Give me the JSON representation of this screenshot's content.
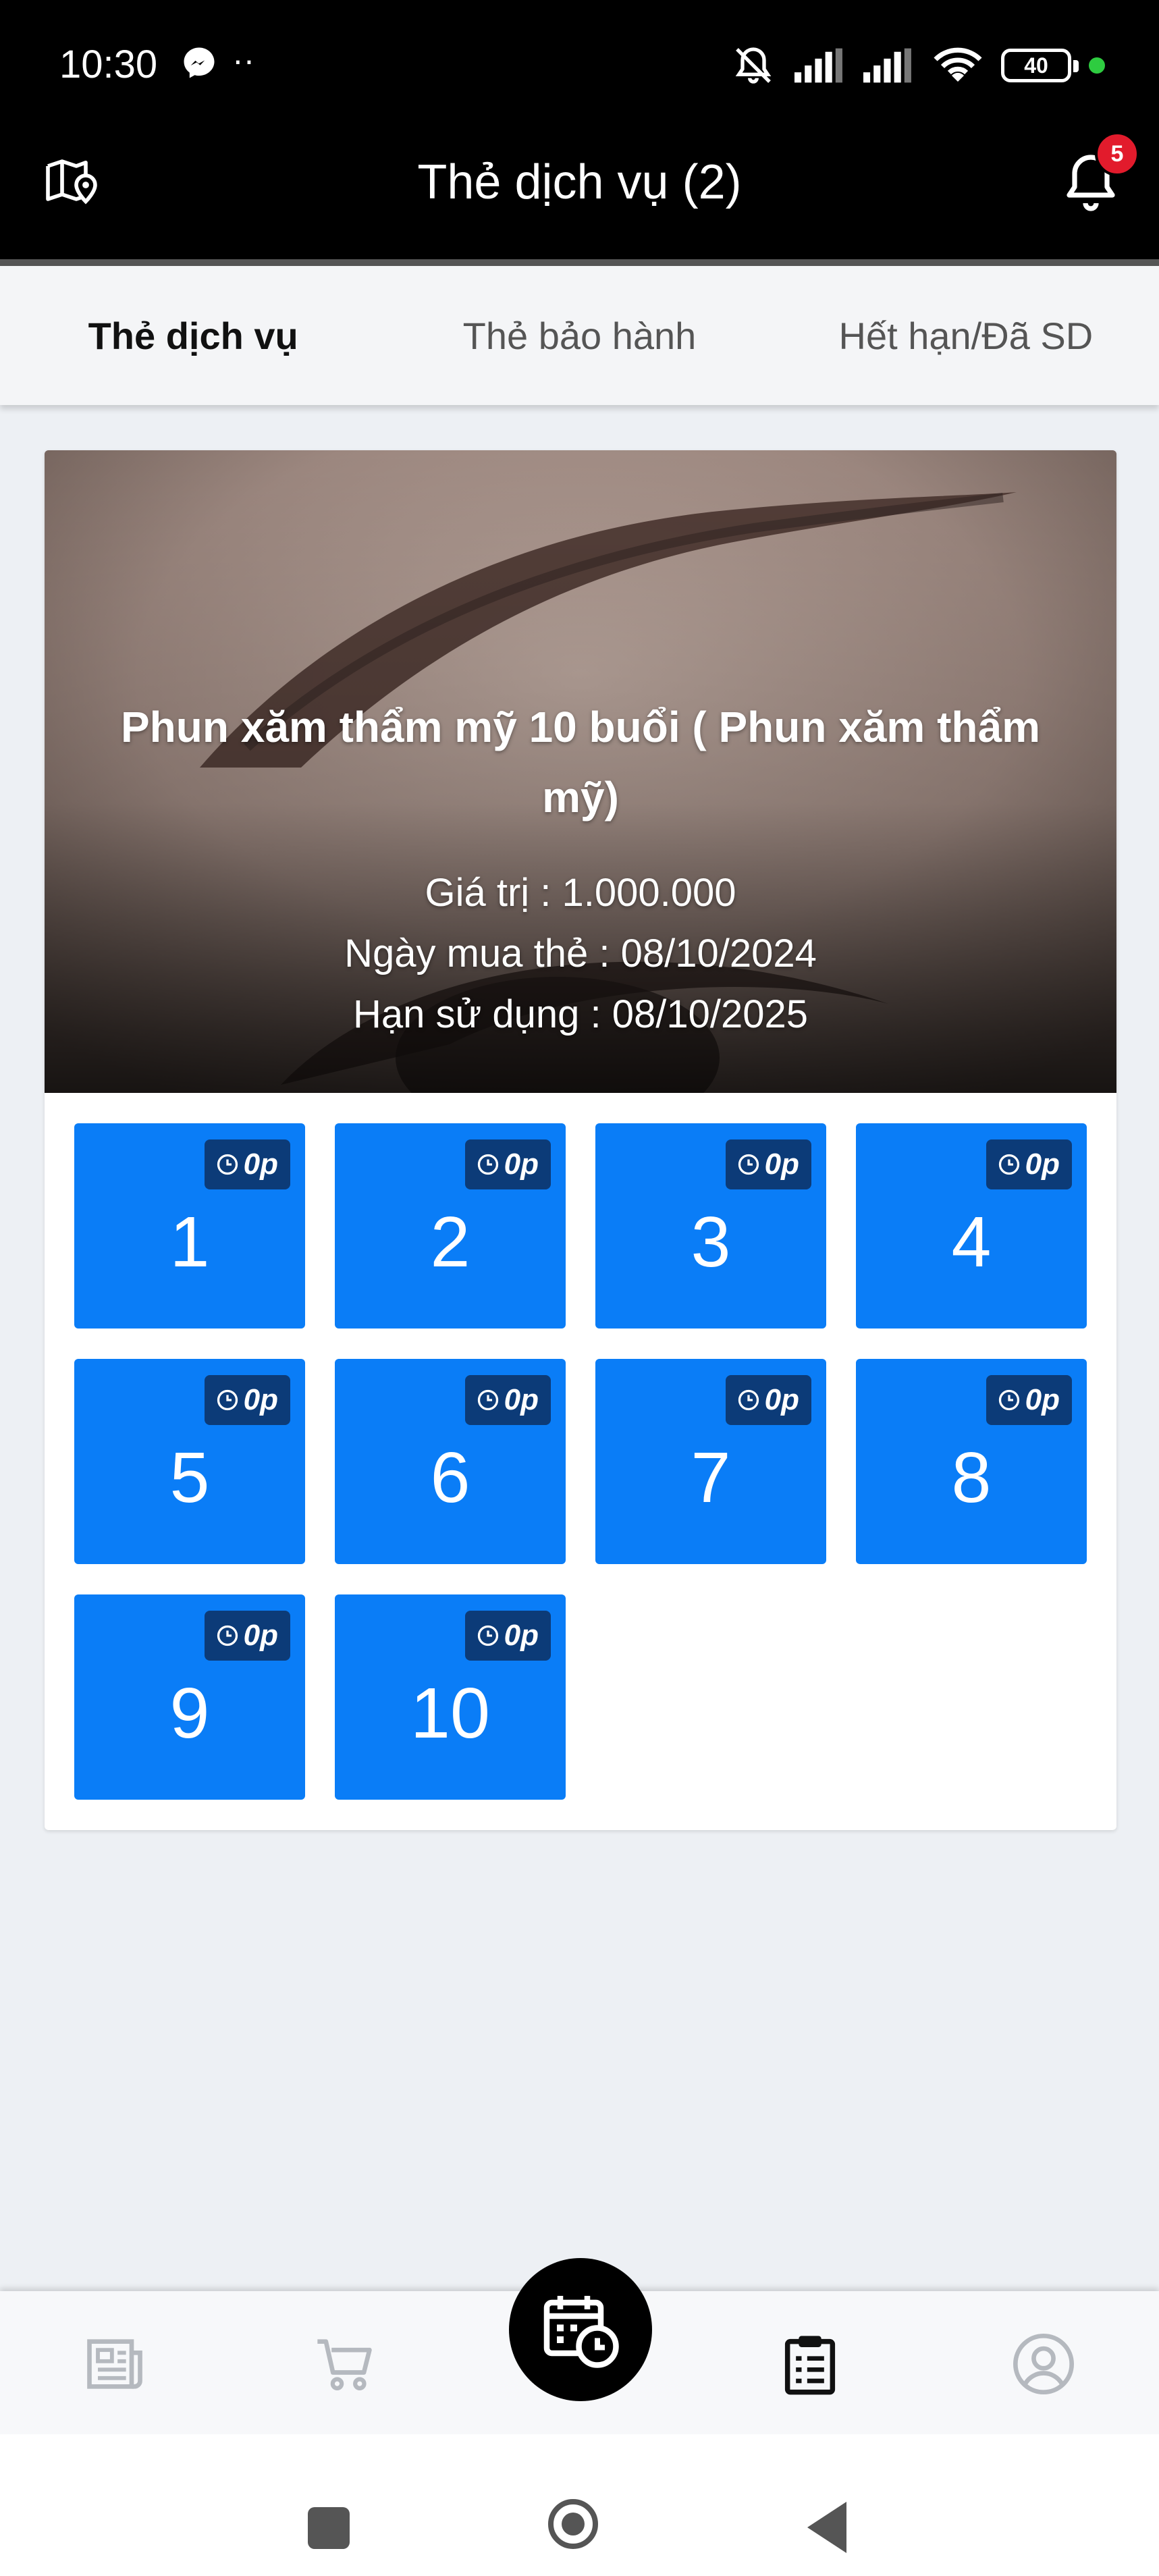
{
  "status_bar": {
    "time": "10:30",
    "dots": "··",
    "battery": "40"
  },
  "header": {
    "title": "Thẻ dịch vụ (2)",
    "notification_count": "5"
  },
  "tabs": [
    {
      "label": "Thẻ dịch vụ",
      "active": true
    },
    {
      "label": "Thẻ bảo hành",
      "active": false
    },
    {
      "label": "Hết hạn/Đã SD",
      "active": false
    }
  ],
  "card": {
    "title": "Phun xăm thẩm mỹ 10 buổi ( Phun xăm thẩm mỹ)",
    "value_line": "Giá trị : 1.000.000",
    "purchase_line": "Ngày mua thẻ : 08/10/2024",
    "expiry_line": "Hạn sử dụng : 08/10/2025",
    "sessions": [
      {
        "number": "1",
        "duration": "0p"
      },
      {
        "number": "2",
        "duration": "0p"
      },
      {
        "number": "3",
        "duration": "0p"
      },
      {
        "number": "4",
        "duration": "0p"
      },
      {
        "number": "5",
        "duration": "0p"
      },
      {
        "number": "6",
        "duration": "0p"
      },
      {
        "number": "7",
        "duration": "0p"
      },
      {
        "number": "8",
        "duration": "0p"
      },
      {
        "number": "9",
        "duration": "0p"
      },
      {
        "number": "10",
        "duration": "0p"
      }
    ]
  },
  "bottom_nav": [
    "news-icon",
    "cart-icon",
    "calendar-clock-icon",
    "clipboard-icon",
    "account-icon"
  ],
  "colors": {
    "accent": "#0a7df7",
    "badge": "#0c3b78",
    "header": "#000000",
    "notification": "#e21b2c"
  }
}
